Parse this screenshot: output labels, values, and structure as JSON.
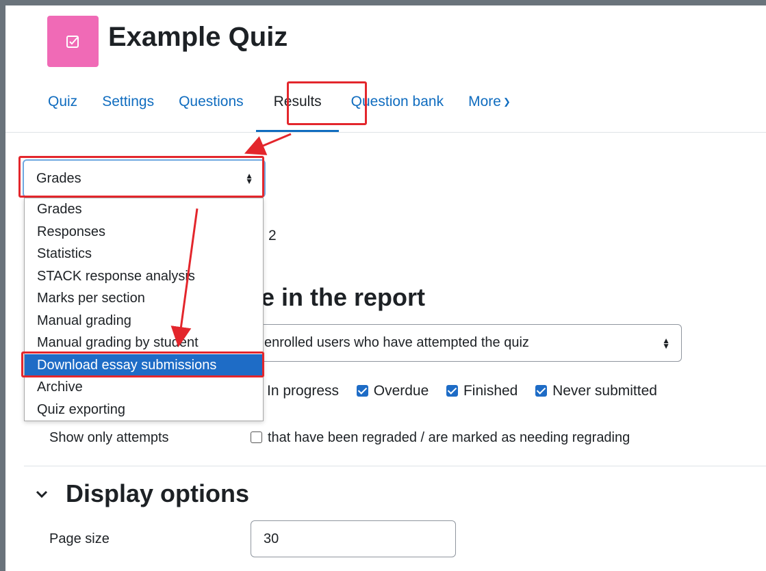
{
  "page": {
    "title": "Example Quiz"
  },
  "tabs": [
    {
      "label": "Quiz"
    },
    {
      "label": "Settings"
    },
    {
      "label": "Questions"
    },
    {
      "label": "Results"
    },
    {
      "label": "Question bank"
    },
    {
      "label": "More"
    }
  ],
  "report_select": {
    "value": "Grades"
  },
  "dropdown": {
    "options": [
      "Grades",
      "Responses",
      "Statistics",
      "STACK response analysis",
      "Marks per section",
      "Manual grading",
      "Manual grading by student",
      "Download essay submissions",
      "Archive",
      "Quiz exporting"
    ],
    "highlighted": "Download essay submissions"
  },
  "background": {
    "partial_number": "2",
    "section_heading_partial": "e in the report",
    "attempts_from_partial": "enrolled users who have attempted the quiz",
    "states": {
      "in_progress": "In progress",
      "overdue": "Overdue",
      "finished": "Finished",
      "never_submitted": "Never submitted"
    },
    "show_only_label": "Show only attempts",
    "regraded_label": "that have been regraded / are marked as needing regrading"
  },
  "display_options": {
    "heading": "Display options",
    "page_size_label": "Page size",
    "page_size_value": "30"
  },
  "annotations": {
    "highlight_color": "#e3262c"
  },
  "icons": {
    "quiz": "quiz-checkbox-icon",
    "collapse": "chevron-down-icon"
  }
}
